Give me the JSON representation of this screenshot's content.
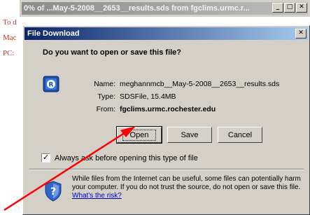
{
  "background": {
    "lines": [
      "To d",
      "Mac",
      "PC:"
    ]
  },
  "back_window": {
    "title": "0% of ...May-5-2008__2653__results.sds from fgclims.urmc.r..."
  },
  "dialog": {
    "title": "File Download",
    "question": "Do you want to open or save this file?",
    "name_label": "Name:",
    "name_value": "meghannmcb__May-5-2008__2653__results.sds",
    "type_label": "Type:",
    "type_value": "SDSFile, 15.4MB",
    "from_label": "From:",
    "from_value": "fgclims.urmc.rochester.edu",
    "buttons": {
      "open": "Open",
      "save": "Save",
      "cancel": "Cancel"
    },
    "checkbox_label": "Always ask before opening this type of file",
    "warning_text": "While files from the Internet can be useful, some files can potentially harm your computer. If you do not trust the source, do not open or save this file.",
    "warning_link": "What's the risk?"
  },
  "colors": {
    "titlebar_active": "#0a246a",
    "titlebar_inactive": "#8c8c8c",
    "dialog_bg": "#d4d0c8",
    "annotation_arrow": "#ff0000",
    "background_text": "#c0392b"
  }
}
